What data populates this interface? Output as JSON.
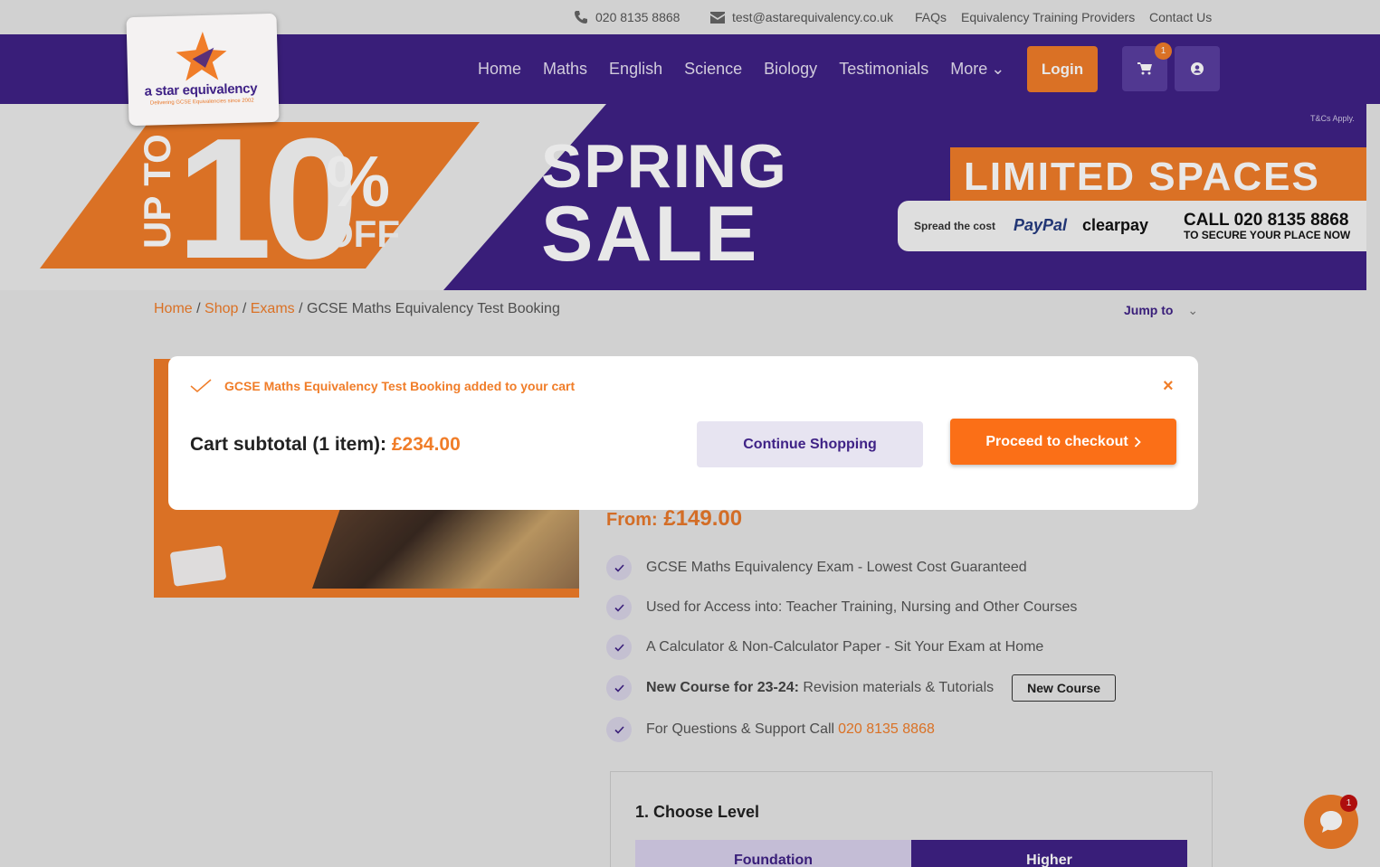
{
  "topbar": {
    "phone": "020 8135 8868",
    "email": "test@astarequivalency.co.uk",
    "links": [
      "FAQs",
      "Equivalency Training Providers",
      "Contact Us"
    ]
  },
  "brand": {
    "name": "a star equivalency",
    "tagline": "Delivering GCSE Equivalencies since 2002",
    "colors": {
      "primary": "#3f2286",
      "accent": "#f07d29"
    }
  },
  "nav": {
    "items": [
      "Home",
      "Maths",
      "English",
      "Science",
      "Biology",
      "Testimonials"
    ],
    "more_label": "More",
    "login_label": "Login",
    "cart_count": "1",
    "icons": [
      "cart-icon",
      "user-icon"
    ]
  },
  "banner": {
    "up_to": "UP TO",
    "ten": "10",
    "percent": "%",
    "off": "OFF",
    "spring": "SPRING",
    "sale": "SALE",
    "tcs": "T&Cs Apply.",
    "limited": "LIMITED SPACES",
    "spread": "Spread the cost",
    "paypal": "PayPal",
    "clearpay": "clearpay",
    "call": "CALL 020 8135 8868",
    "secure": "TO SECURE YOUR PLACE NOW"
  },
  "breadcrumb": {
    "home": "Home",
    "shop": "Shop",
    "exams": "Exams",
    "current": "GCSE Maths Equivalency Test Booking",
    "jump_label": "Jump to"
  },
  "product": {
    "price_prefix": "From:",
    "price": "£149.00",
    "features": [
      {
        "text": "GCSE Maths Equivalency Exam - Lowest Cost Guaranteed"
      },
      {
        "text": "Used for Access into: Teacher Training, Nursing and Other Courses"
      },
      {
        "text": "A Calculator & Non-Calculator Paper - Sit Your Exam at Home"
      },
      {
        "bold": "New Course for 23-24:",
        "text": "Revision materials & Tutorials",
        "badge": "New Course"
      },
      {
        "text": "For Questions & Support Call",
        "link": "020 8135 8868"
      }
    ],
    "level_title": "1. Choose Level",
    "levels": [
      "Foundation",
      "Higher"
    ]
  },
  "modal": {
    "added_message": "GCSE Maths Equivalency Test Booking added to your cart",
    "subtotal_label": "Cart subtotal (1 item):",
    "subtotal_amount": "£234.00",
    "continue_label": "Continue Shopping",
    "checkout_label": "Proceed to checkout",
    "close_glyph": "×"
  },
  "chat": {
    "badge": "1"
  }
}
